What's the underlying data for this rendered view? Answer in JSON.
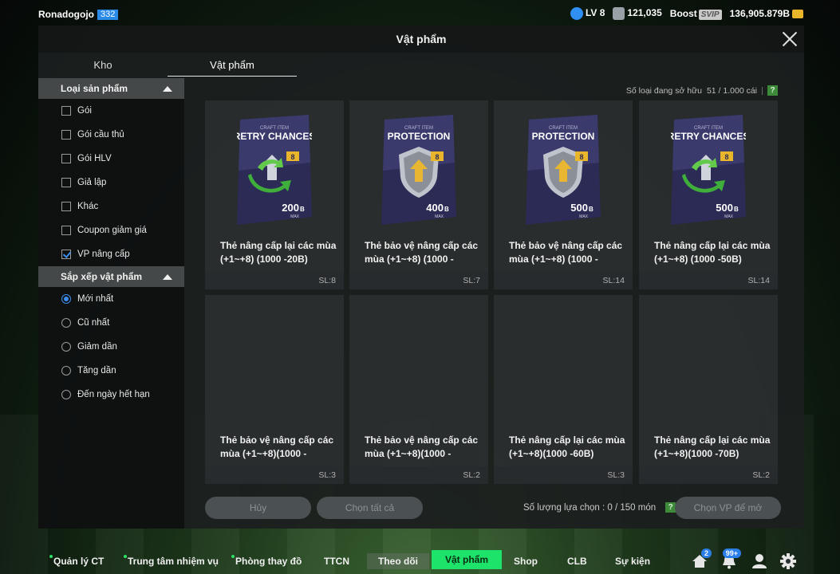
{
  "topbar": {
    "username": "Ronadogojo",
    "user_level": "332",
    "level": "LV 8",
    "points": "121,035",
    "boost": "Boost",
    "svip": "SVIP",
    "bp": "136,905.879B"
  },
  "modal": {
    "title": "Vật phẩm",
    "tabs": [
      "Kho",
      "Vật phẩm"
    ],
    "active_tab": "Vật phẩm"
  },
  "sidebar": {
    "category_header": "Loại sản phẩm",
    "categories": [
      {
        "label": "Gói",
        "checked": false
      },
      {
        "label": "Gói cầu thủ",
        "checked": false
      },
      {
        "label": "Gói HLV",
        "checked": false
      },
      {
        "label": "Giả lập",
        "checked": false
      },
      {
        "label": "Khác",
        "checked": false
      },
      {
        "label": "Coupon giảm giá",
        "checked": false
      },
      {
        "label": "VP nâng cấp",
        "checked": true
      }
    ],
    "sort_header": "Sắp xếp vật phẩm",
    "sorts": [
      {
        "label": "Mới nhất",
        "selected": true
      },
      {
        "label": "Cũ nhất",
        "selected": false
      },
      {
        "label": "Giảm dần",
        "selected": false
      },
      {
        "label": "Tăng dần",
        "selected": false
      },
      {
        "label": "Đến ngày hết hạn",
        "selected": false
      }
    ]
  },
  "owned": {
    "label": "Số loại đang sở hữu",
    "value": "51 / 1.000 cái",
    "help": "?"
  },
  "items": [
    {
      "name": "Thẻ nâng cấp lại các mùa (+1~+8) (1000 -20B)",
      "qty": "SL:8",
      "pack_type": "retry",
      "pack_top": "CRAFT ITEM",
      "pack_title": "RETRY CHANCES",
      "pack_level": "8",
      "pack_value": "200",
      "pack_unit": "B",
      "pack_max": "MAX",
      "icon": "retry-arrows-icon"
    },
    {
      "name": "Thẻ bảo vệ nâng cấp các mùa (+1~+8) (1000 -",
      "qty": "SL:7",
      "pack_type": "protection",
      "pack_top": "CRAFT ITEM",
      "pack_title": "PROTECTION",
      "pack_level": "8",
      "pack_value": "400",
      "pack_unit": "B",
      "pack_max": "MAX",
      "icon": "shield-arrow-icon"
    },
    {
      "name": "Thẻ bảo vệ nâng cấp các mùa (+1~+8) (1000 -",
      "qty": "SL:14",
      "pack_type": "protection",
      "pack_top": "CRAFT ITEM",
      "pack_title": "PROTECTION",
      "pack_level": "8",
      "pack_value": "500",
      "pack_unit": "B",
      "pack_max": "MAX",
      "icon": "shield-arrow-icon"
    },
    {
      "name": "Thẻ nâng cấp lại các mùa (+1~+8) (1000 -50B)",
      "qty": "SL:14",
      "pack_type": "retry",
      "pack_top": "CRAFT ITEM",
      "pack_title": "RETRY CHANCES",
      "pack_level": "8",
      "pack_value": "500",
      "pack_unit": "B",
      "pack_max": "MAX",
      "icon": "retry-arrows-icon"
    },
    {
      "name": "Thẻ bảo vệ nâng cấp các mùa (+1~+8)(1000 -",
      "qty": "SL:3"
    },
    {
      "name": "Thẻ bảo vệ nâng cấp các mùa (+1~+8)(1000 -",
      "qty": "SL:2"
    },
    {
      "name": "Thẻ nâng cấp lại các mùa (+1~+8)(1000 -60B)",
      "qty": "SL:3"
    },
    {
      "name": "Thẻ nâng cấp lại các mùa (+1~+8)(1000 -70B)",
      "qty": "SL:2"
    }
  ],
  "actions": {
    "cancel": "Hủy",
    "select_all": "Chọn tất cả",
    "selection_count": "Số lượng lựa chọn : 0 / 150 món",
    "help": "?",
    "open": "Chọn VP để mở"
  },
  "nav": {
    "items": [
      {
        "label": "Quản lý CT",
        "dot": true
      },
      {
        "label": "Trung tâm nhiệm vụ",
        "dot": true
      },
      {
        "label": "Phòng thay đồ",
        "dot": true
      },
      {
        "label": "TTCN",
        "dot": false
      },
      {
        "label": "Theo dõi",
        "dot": false
      },
      {
        "label": "Vật phẩm",
        "dot": false
      },
      {
        "label": "Shop",
        "dot": false
      },
      {
        "label": "CLB",
        "dot": false
      },
      {
        "label": "Sự kiện",
        "dot": false
      }
    ],
    "active": "Vật phẩm",
    "home_badge": "2",
    "bell_badge": "99+"
  },
  "colors": {
    "accent_green": "#1ee36a",
    "select_blue": "#3b8ef0",
    "pack_purple": "#3a3a6e"
  }
}
